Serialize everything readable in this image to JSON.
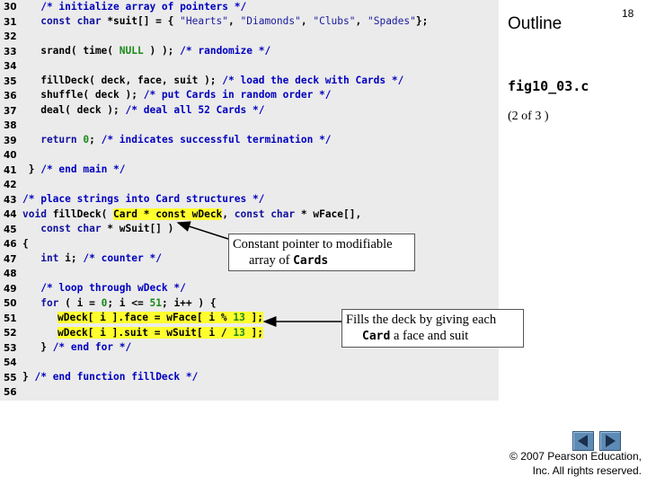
{
  "slide": {
    "title": "Outline",
    "page_number": "18",
    "figure_name": "fig10_03.c",
    "page_of": "(2 of 3 )",
    "copyright_line1": "© 2007 Pearson Education,",
    "copyright_line2": "Inc.  All rights reserved."
  },
  "callouts": {
    "pointer_line1": "Constant pointer to modifiable",
    "pointer_line2_pre": "array of ",
    "pointer_line2_code": "Cards",
    "fill_line1": "Fills the deck by giving each",
    "fill_line2_code": "Card",
    "fill_line2_post": " a face and suit"
  },
  "nav": {
    "prev_icon": "triangle-left-icon",
    "next_icon": "triangle-right-icon",
    "button_color": "#5e8bb5"
  },
  "code": {
    "line_numbers": [
      "30",
      "31",
      "32",
      "33",
      "34",
      "35",
      "36",
      "37",
      "38",
      "39",
      "40",
      "41",
      "42",
      "43",
      "44",
      "45",
      "46",
      "47",
      "48",
      "49",
      "50",
      "51",
      "52",
      "53",
      "54",
      "55",
      "56"
    ],
    "l30": "   /* initialize array of pointers */",
    "l31a": "   const char ",
    "l31b": "*suit[] = { ",
    "l31c": "\"Hearts\"",
    "l31d": ", ",
    "l31e": "\"Diamonds\"",
    "l31f": ", ",
    "l31g": "\"Clubs\"",
    "l31h": ", ",
    "l31i": "\"Spades\"",
    "l31j": "};",
    "l33a": "   srand( time( ",
    "l33b": "NULL",
    "l33c": " ) ); ",
    "l33d": "/* randomize */",
    "l35a": "   fillDeck( deck, face, suit ); ",
    "l35b": "/* load the deck with Cards */",
    "l36a": "   shuffle( deck ); ",
    "l36b": "/* put Cards in random order */",
    "l37a": "   deal( deck ); ",
    "l37b": "/* deal all 52 Cards */",
    "l39a": "   return ",
    "l39b": "0",
    "l39c": "; ",
    "l39d": "/* indicates successful termination */",
    "l41a": " } ",
    "l41b": "/* end main */",
    "l43": "/* place strings into Card structures */",
    "l44a": "void ",
    "l44b": "fillDeck( ",
    "l44c": "Card * const wDeck",
    "l44d": ", ",
    "l44e": "const char ",
    "l44f": "* wFace[],",
    "l45a": "   const char ",
    "l45b": "* wSuit[] )",
    "l46": "{",
    "l47a": "   int ",
    "l47b": "i; ",
    "l47c": "/* counter */",
    "l49": "   /* loop through wDeck */",
    "l50a": "   for ",
    "l50b": "( i = ",
    "l50c": "0",
    "l50d": "; i <= ",
    "l50e": "51",
    "l50f": "; i++ ) {",
    "l51a": "wDeck[ i ].face = wFace[ i % ",
    "l51b": "13",
    "l51c": " ];",
    "l52a": "wDeck[ i ].suit = wSuit[ i / ",
    "l52b": "13",
    "l52c": " ];",
    "l53a": "   } ",
    "l53b": "/* end for */",
    "l55a": "} ",
    "l55b": "/* end function fillDeck */"
  }
}
